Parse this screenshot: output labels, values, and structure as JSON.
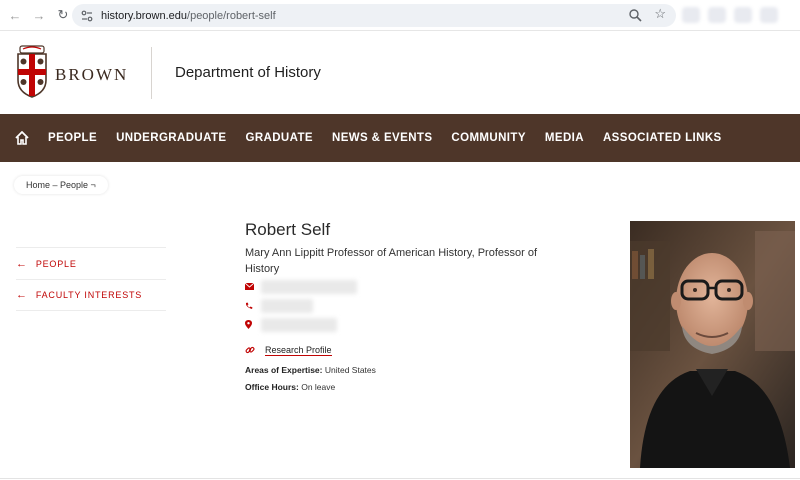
{
  "browser": {
    "url_host": "history.brown.edu",
    "url_path": "/people/robert-self",
    "icons": [
      "back-icon",
      "forward-icon",
      "reload-icon",
      "site-settings-icon",
      "zoom-icon",
      "bookmark-star-icon"
    ]
  },
  "header": {
    "brand": "BROWN",
    "department": "Department of History"
  },
  "nav": {
    "items": [
      "PEOPLE",
      "UNDERGRADUATE",
      "GRADUATE",
      "NEWS & EVENTS",
      "COMMUNITY",
      "MEDIA",
      "ASSOCIATED LINKS"
    ]
  },
  "breadcrumb": "Home – People ¬",
  "sidebar": {
    "links": [
      "PEOPLE",
      "FACULTY INTERESTS"
    ]
  },
  "profile": {
    "name": "Robert Self",
    "title": "Mary Ann Lippitt Professor of American History, Professor of History",
    "research_link": "Research Profile",
    "expertise_label": "Areas of Expertise:",
    "expertise_value": "United States",
    "office_label": "Office Hours:",
    "office_value": "On leave"
  },
  "colors": {
    "brand_brown": "#4e3629",
    "accent_red": "#c00404"
  }
}
